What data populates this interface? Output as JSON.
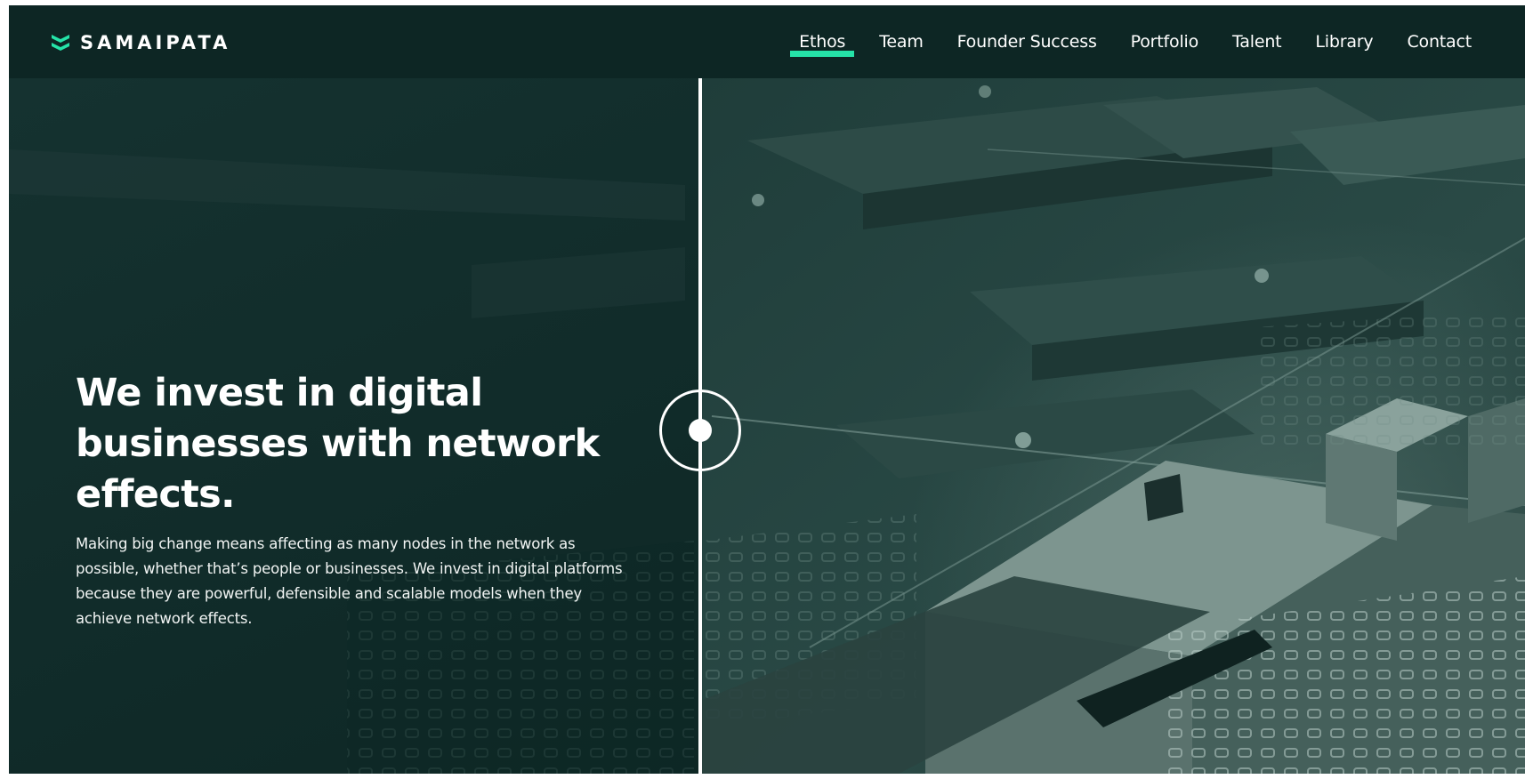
{
  "brand": {
    "name": "SAMAIPATA",
    "accent": "#25e3a8"
  },
  "nav": {
    "items": [
      {
        "label": "Ethos",
        "active": true
      },
      {
        "label": "Team"
      },
      {
        "label": "Founder Success"
      },
      {
        "label": "Portfolio"
      },
      {
        "label": "Talent"
      },
      {
        "label": "Library"
      },
      {
        "label": "Contact"
      }
    ]
  },
  "hero": {
    "headline_lines": [
      "We invest in digital",
      "businesses with network",
      "effects."
    ],
    "body": "Making big change means affecting as many nodes in the network as possible, whether that’s people or businesses. We invest in digital platforms because they are powerful, defensible and scalable models when they achieve network effects."
  },
  "colors": {
    "header_bg": "#0d2624",
    "hero_bg": "#0f2a28",
    "text": "#ffffff"
  }
}
